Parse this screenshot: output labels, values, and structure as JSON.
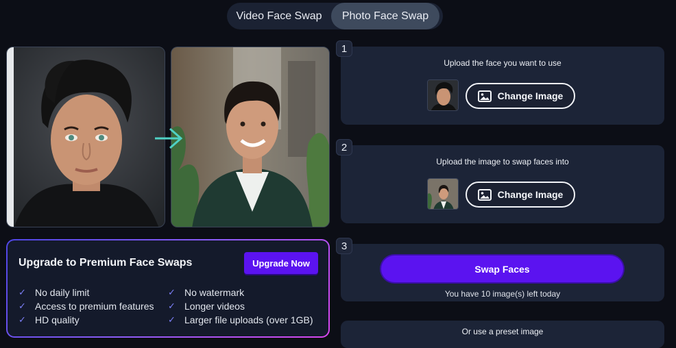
{
  "tabs": [
    {
      "label": "Video Face Swap",
      "active": false
    },
    {
      "label": "Photo Face Swap",
      "active": true
    }
  ],
  "upgrade": {
    "title": "Upgrade to Premium Face Swaps",
    "button": "Upgrade Now",
    "features_left": [
      "No daily limit",
      "Access to premium features",
      "HD quality"
    ],
    "features_right": [
      "No watermark",
      "Longer videos",
      "Larger file uploads (over 1GB)"
    ]
  },
  "steps": [
    {
      "number": "1",
      "label": "Upload the face you want to use",
      "button": "Change Image"
    },
    {
      "number": "2",
      "label": "Upload the image to swap faces into",
      "button": "Change Image"
    },
    {
      "number": "3",
      "button": "Swap Faces",
      "remaining": "You have 10 image(s) left today"
    }
  ],
  "preset": {
    "label": "Or use a preset image"
  },
  "icons": {
    "arrow": "arrow-right-icon",
    "image": "image-icon",
    "check": "check-icon"
  },
  "colors": {
    "accent": "#5b13f0",
    "card": "#1c2437",
    "background": "#0c0e16",
    "arrow": "#4fd1c5"
  }
}
